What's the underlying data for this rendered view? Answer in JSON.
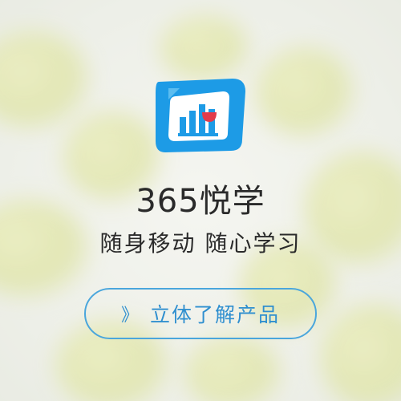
{
  "brand": {
    "name": "365悦学"
  },
  "slogan": "随身移动  随心学习",
  "cta": {
    "arrow": "》",
    "label": "立体了解产品"
  },
  "colors": {
    "brand_blue": "#1d9be6",
    "cta_blue": "#2f8fcf",
    "accent_red": "#e33b4a",
    "text": "#2a2a2a"
  },
  "icons": [
    "logo-icon",
    "chevron-right-icon"
  ]
}
